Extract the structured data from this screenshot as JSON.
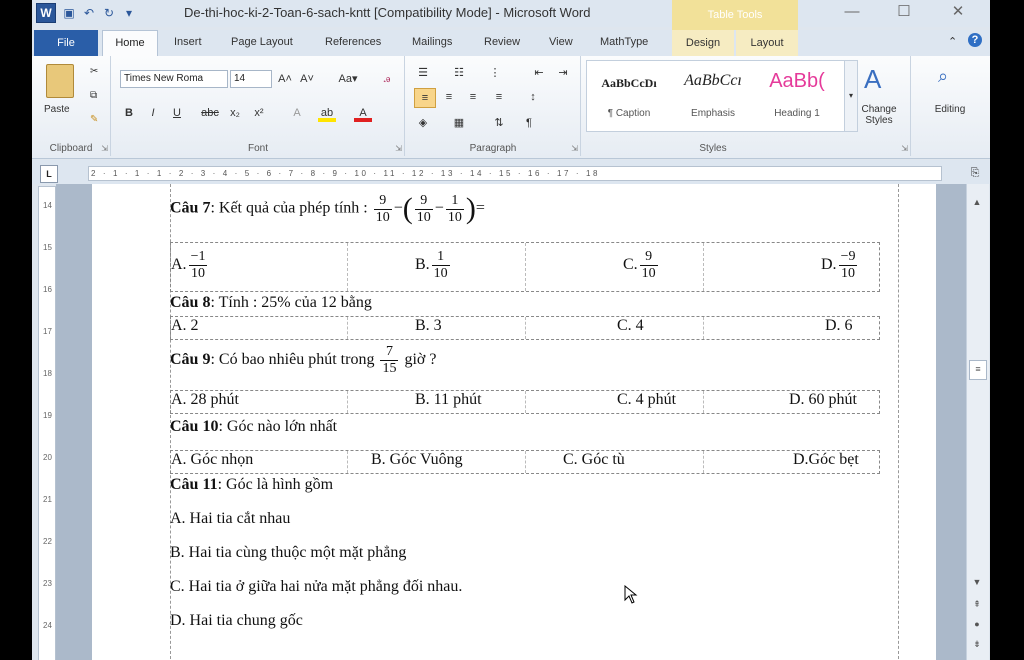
{
  "window": {
    "title": "De-thi-hoc-ki-2-Toan-6-sach-kntt [Compatibility Mode]  -  Microsoft Word",
    "table_tools": "Table Tools",
    "app_icon": "W"
  },
  "tabs": [
    "File",
    "Home",
    "Insert",
    "Page Layout",
    "References",
    "Mailings",
    "Review",
    "View",
    "MathType",
    "Design",
    "Layout"
  ],
  "ribbon": {
    "clipboard": {
      "paste": "Paste",
      "label": "Clipboard"
    },
    "font": {
      "name": "Times New Roma",
      "size": "14",
      "label": "Font"
    },
    "paragraph": {
      "label": "Paragraph"
    },
    "styles": {
      "label": "Styles",
      "items": [
        {
          "sample": "AaBbCcDı",
          "name": "¶ Caption"
        },
        {
          "sample": "AaBbCcı",
          "name": "Emphasis"
        },
        {
          "sample": "AaBb(",
          "name": "Heading 1"
        }
      ],
      "change_styles": "Change Styles"
    },
    "editing": {
      "label": "Editing"
    }
  },
  "ruler": {
    "marks": "2 · 1 · 1 · 1 · 2 · 3 · 4 · 5 · 6 · 7 · 8 · 9 · 10 · 11 · 12 · 13 · 14 · 15 · 16 · 17 · 18",
    "tab_selector": "L",
    "vertical_marks": [
      "14",
      "15",
      "16",
      "17",
      "18",
      "19",
      "20",
      "21",
      "22",
      "23",
      "24"
    ]
  },
  "document": {
    "q7": {
      "label": "Câu 7",
      "text": ": Kết quả của phép tính :",
      "frac1": [
        "9",
        "10"
      ],
      "frac2": [
        "9",
        "10"
      ],
      "frac3": [
        "1",
        "10"
      ],
      "eq": "=",
      "opts": [
        {
          "letter": "A.",
          "num": "−1",
          "den": "10"
        },
        {
          "letter": "B.",
          "num": "1",
          "den": "10"
        },
        {
          "letter": "C.",
          "num": "9",
          "den": "10"
        },
        {
          "letter": "D.",
          "num": "−9",
          "den": "10"
        }
      ]
    },
    "q8": {
      "label": "Câu 8",
      "text": ": Tính : 25% của 12 bằng",
      "opts": [
        "A. 2",
        "B. 3",
        "C. 4",
        "D. 6"
      ]
    },
    "q9": {
      "label": "Câu 9",
      "text": ": Có bao nhiêu phút trong",
      "frac": [
        "7",
        "15"
      ],
      "tail": "giờ ?",
      "opts": [
        "A. 28 phút",
        "B. 11 phút",
        "C. 4 phút",
        "D. 60 phút"
      ]
    },
    "q10": {
      "label": "Câu 10",
      "text": ": Góc nào lớn nhất",
      "opts": [
        "A. Góc nhọn",
        "B. Góc Vuông",
        "C. Góc tù",
        "D.Góc bẹt"
      ]
    },
    "q11": {
      "label": "Câu 11",
      "text": ": Góc là hình gồm",
      "opts": [
        "A. Hai tia cắt nhau",
        "B. Hai tia cùng thuộc một mặt phẳng",
        "C. Hai tia ở giữa hai nửa mặt phẳng đối nhau.",
        "D. Hai tia chung gốc"
      ]
    }
  }
}
